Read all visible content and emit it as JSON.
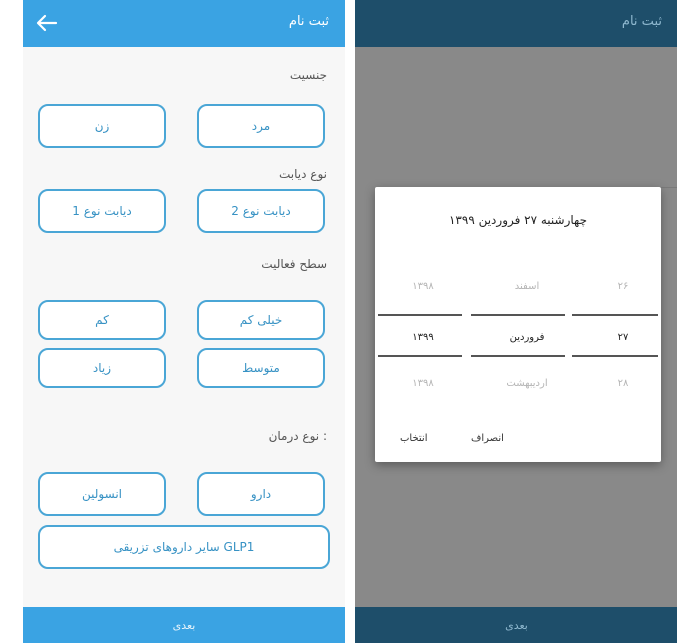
{
  "left_screen": {
    "appbar": {
      "title": "ثبت نام",
      "back_icon": "arrow-left-icon"
    },
    "gender": {
      "label": "جنسیت",
      "options": [
        "مرد",
        "زن"
      ]
    },
    "diabetes_type": {
      "label": "نوع دیابت",
      "options": [
        "دیابت نوع 2",
        "دیابت نوع 1"
      ]
    },
    "activity_level": {
      "label": "سطح فعالیت",
      "options": [
        "خیلی کم",
        "کم",
        "متوسط",
        "زیاد"
      ]
    },
    "treatment_type": {
      "label": "نوع درمان :",
      "options": [
        "دارو",
        "انسولین"
      ],
      "wide_option": "سایر داروهای تزریقی GLP1"
    },
    "next_label": "بعدی"
  },
  "right_screen": {
    "appbar": {
      "title": "ثبت نام"
    },
    "date_dialog": {
      "title": "چهارشنبه ۲۷ فروردین ۱۳۹۹",
      "rows": [
        {
          "day": "۲۶",
          "month": "اسفند",
          "year": "۱۳۹۸"
        },
        {
          "day": "۲۷",
          "month": "فروردین",
          "year": "۱۳۹۹"
        },
        {
          "day": "۲۸",
          "month": "اردیبهشت",
          "year": "۱۳۹۸"
        }
      ],
      "selected_row": 1,
      "cancel_label": "انصراف",
      "select_label": "انتخاب"
    },
    "next_label": "بعدی"
  },
  "colors": {
    "primary": "#3aa3e3",
    "primary_dark": "#1e4e6a",
    "button_border": "#4aa6d6",
    "button_text": "#3792c4"
  }
}
